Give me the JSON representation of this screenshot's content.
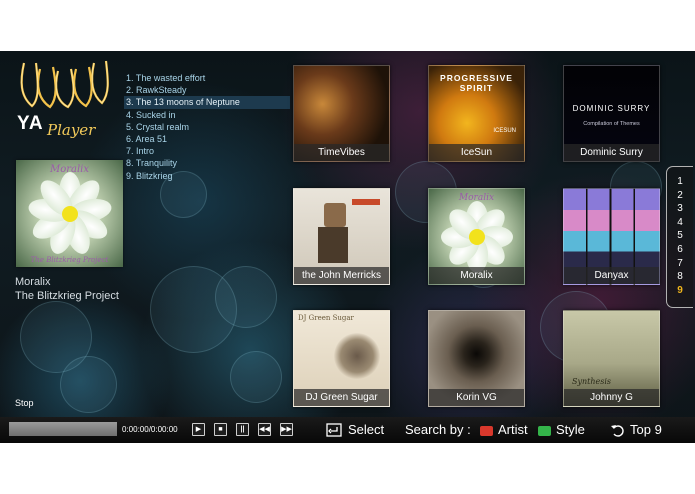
{
  "app": {
    "logo_ya": "YA",
    "logo_player": "Player"
  },
  "now_playing": {
    "cover_title": "Moralix",
    "cover_subtitle": "The Blitzkrieg Project",
    "artist": "Moralix",
    "album": "The Blitzkrieg Project",
    "status": "Stop"
  },
  "tracks": [
    {
      "label": "1. The wasted effort"
    },
    {
      "label": "2. RawkSteady"
    },
    {
      "label": "3. The 13 moons of Neptune",
      "selected": true
    },
    {
      "label": "4. Sucked in"
    },
    {
      "label": "5. Crystal realm"
    },
    {
      "label": "6. Area 51"
    },
    {
      "label": "7. Intro"
    },
    {
      "label": "8. Tranquility"
    },
    {
      "label": "9. Blitzkrieg"
    }
  ],
  "albums": [
    {
      "name": "TimeVibes"
    },
    {
      "name": "IceSun",
      "cover_text": "PROGRESSIVE SPIRIT",
      "cover_text2": "ICESUN"
    },
    {
      "name": "Dominic Surry",
      "cover_text": "DOMINIC SURRY",
      "cover_text2": "Compilation of Themes"
    },
    {
      "name": "the John Merricks"
    },
    {
      "name": "Moralix",
      "cover_text": "Moralix"
    },
    {
      "name": "Danyax"
    },
    {
      "name": "DJ Green Sugar",
      "cover_text": "DJ Green Sugar"
    },
    {
      "name": "Korin VG"
    },
    {
      "name": "Johnny G",
      "cover_text": "Synthesis"
    }
  ],
  "pager": {
    "pages": [
      "1",
      "2",
      "3",
      "4",
      "5",
      "6",
      "7",
      "8",
      "9"
    ],
    "current": "9"
  },
  "playback": {
    "time": "0:00:00/0:00:00",
    "progress": 0
  },
  "controls": [
    {
      "name": "play-button",
      "icon": "play-icon"
    },
    {
      "name": "stop-button",
      "icon": "stop-icon"
    },
    {
      "name": "pause-button",
      "icon": "pause-icon"
    },
    {
      "name": "rewind-button",
      "icon": "rewind-icon"
    },
    {
      "name": "forward-button",
      "icon": "fast-forward-icon"
    }
  ],
  "hints": {
    "select": "Select",
    "search_by": "Search by :",
    "artist": "Artist",
    "style": "Style",
    "top": "Top 9"
  },
  "colors": {
    "artist_key": "#d9382c",
    "style_key": "#34b44a",
    "pager_current": "#f0b51c",
    "track_text": "#a9d4e8"
  }
}
